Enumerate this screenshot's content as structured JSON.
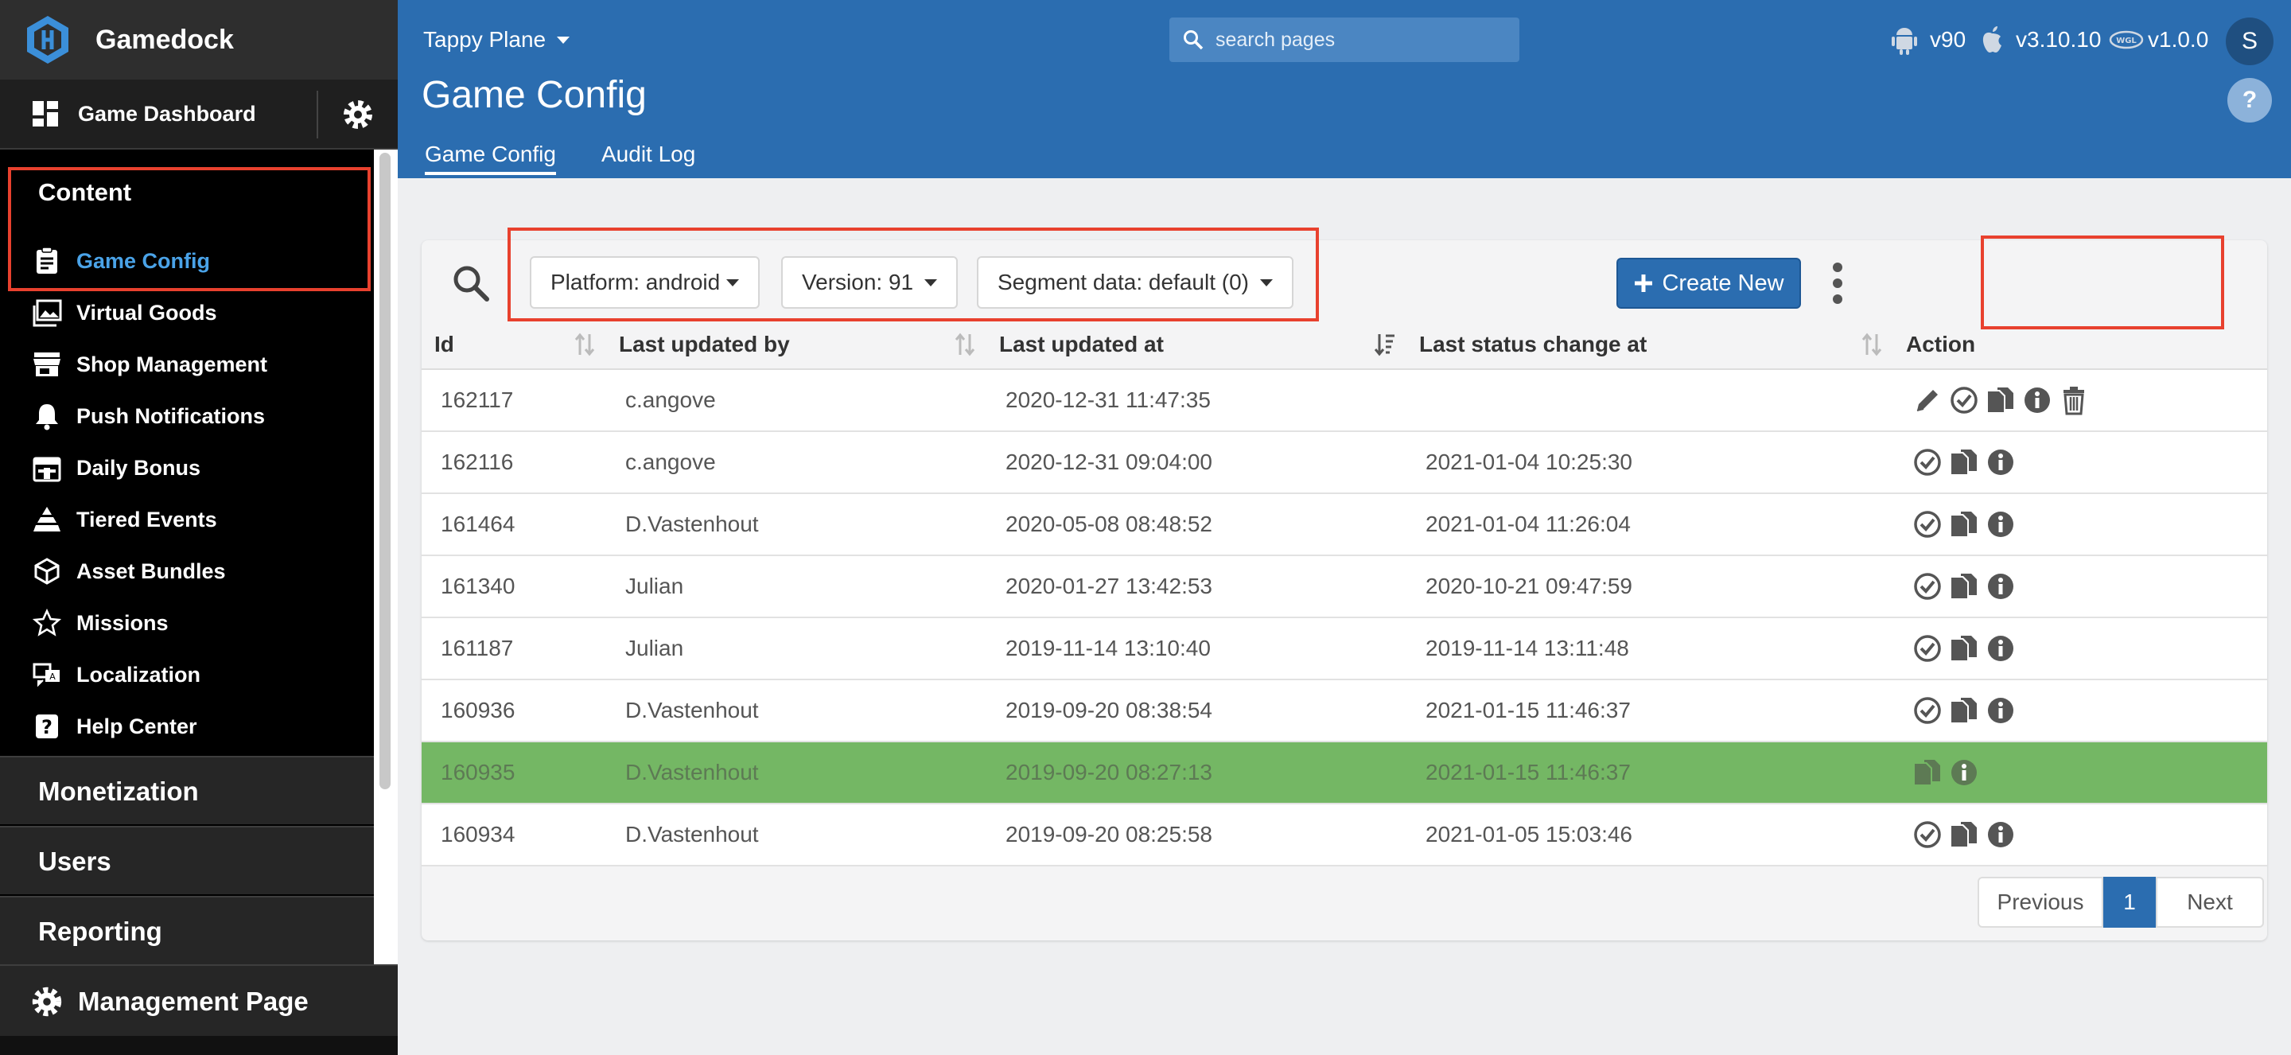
{
  "sidebar": {
    "brand": "Gamedock",
    "dashboard_label": "Game Dashboard",
    "section_title": "Content",
    "items": [
      {
        "label": "Game Config",
        "icon": "clipboard-icon",
        "active": true
      },
      {
        "label": "Virtual Goods",
        "icon": "images-icon"
      },
      {
        "label": "Shop Management",
        "icon": "store-icon"
      },
      {
        "label": "Push Notifications",
        "icon": "bell-icon"
      },
      {
        "label": "Daily Bonus",
        "icon": "calendar-gift-icon"
      },
      {
        "label": "Tiered Events",
        "icon": "pyramid-icon"
      },
      {
        "label": "Asset Bundles",
        "icon": "unity-icon"
      },
      {
        "label": "Missions",
        "icon": "star-icon"
      },
      {
        "label": "Localization",
        "icon": "translate-icon"
      },
      {
        "label": "Help Center",
        "icon": "question-icon"
      }
    ],
    "sections": [
      "Monetization",
      "Users",
      "Reporting"
    ],
    "management_label": "Management Page"
  },
  "header": {
    "game_name": "Tappy Plane",
    "title": "Game Config",
    "tabs": [
      "Game Config",
      "Audit Log"
    ],
    "search_placeholder": "search pages",
    "versions": {
      "android": "v90",
      "ios": "v3.10.10",
      "webgl": "v1.0.0"
    },
    "avatar_initial": "S",
    "help": "?"
  },
  "filters": {
    "platform": "Platform: android",
    "version": "Version: 91",
    "segment": "Segment data: default (0)"
  },
  "create_label": "Create New",
  "table": {
    "columns": [
      "Id",
      "Last updated by",
      "Last updated at",
      "Last status change at",
      "Action"
    ],
    "rows": [
      {
        "id": "162117",
        "by": "c.angove",
        "at": "2020-12-31 11:47:35",
        "status": "",
        "actions": [
          "edit",
          "activate",
          "copy",
          "info",
          "delete"
        ]
      },
      {
        "id": "162116",
        "by": "c.angove",
        "at": "2020-12-31 09:04:00",
        "status": "2021-01-04 10:25:30",
        "actions": [
          "activate",
          "copy",
          "info"
        ]
      },
      {
        "id": "161464",
        "by": "D.Vastenhout",
        "at": "2020-05-08 08:48:52",
        "status": "2021-01-04 11:26:04",
        "actions": [
          "activate",
          "copy",
          "info"
        ]
      },
      {
        "id": "161340",
        "by": "Julian",
        "at": "2020-01-27 13:42:53",
        "status": "2020-10-21 09:47:59",
        "actions": [
          "activate",
          "copy",
          "info"
        ]
      },
      {
        "id": "161187",
        "by": "Julian",
        "at": "2019-11-14 13:10:40",
        "status": "2019-11-14 13:11:48",
        "actions": [
          "activate",
          "copy",
          "info"
        ]
      },
      {
        "id": "160936",
        "by": "D.Vastenhout",
        "at": "2019-09-20 08:38:54",
        "status": "2021-01-15 11:46:37",
        "actions": [
          "activate",
          "copy",
          "info"
        ]
      },
      {
        "id": "160935",
        "by": "D.Vastenhout",
        "at": "2019-09-20 08:27:13",
        "status": "2021-01-15 11:46:37",
        "actions": [
          "copy",
          "info"
        ],
        "highlight": true
      },
      {
        "id": "160934",
        "by": "D.Vastenhout",
        "at": "2019-09-20 08:25:58",
        "status": "2021-01-05 15:03:46",
        "actions": [
          "activate",
          "copy",
          "info"
        ]
      }
    ]
  },
  "pagination": {
    "previous": "Previous",
    "current": "1",
    "next": "Next"
  },
  "colors": {
    "header": "#2b6db0",
    "active_link": "#4aa3e8",
    "highlight_row": "#74b764",
    "annotation": "#e8412e"
  }
}
